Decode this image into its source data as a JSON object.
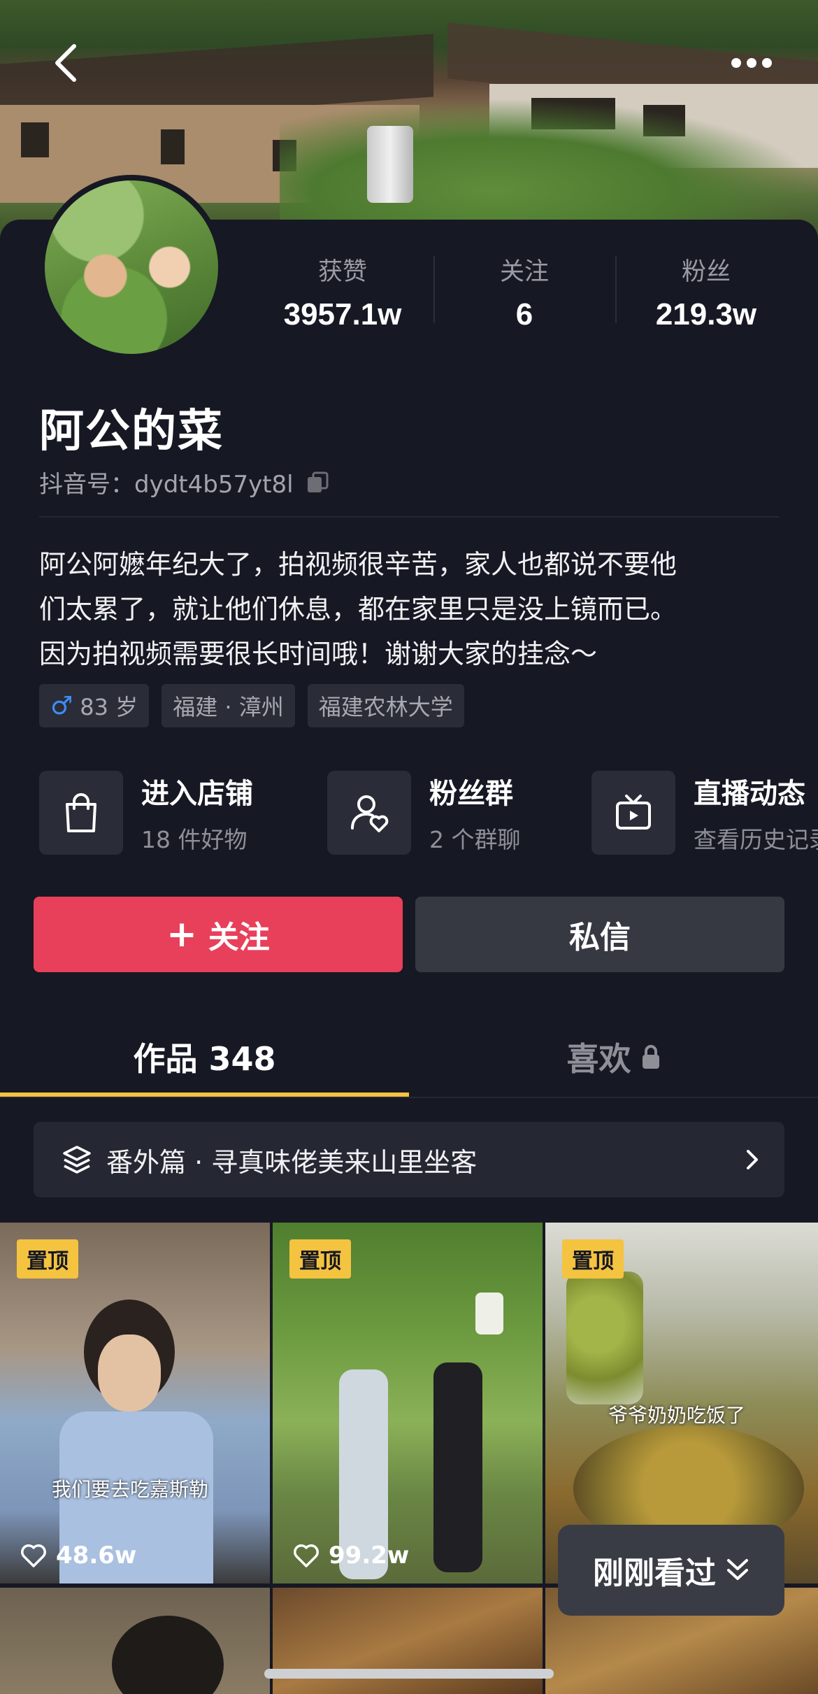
{
  "header": {
    "back_icon": "chevron-left-icon",
    "more_icon": "more-dots-icon"
  },
  "profile": {
    "stats": [
      {
        "label": "获赞",
        "value": "3957.1w"
      },
      {
        "label": "关注",
        "value": "6"
      },
      {
        "label": "粉丝",
        "value": "219.3w"
      }
    ],
    "name": "阿公的菜",
    "douyin_id": "抖音号：dydt4b57yt8l",
    "bio_lines": [
      "阿公阿嬷年纪大了，拍视频很辛苦，家人也都说不要他",
      "们太累了，就让他们休息，都在家里只是没上镜而已。",
      "因为拍视频需要很长时间哦！谢谢大家的挂念～"
    ],
    "tags": {
      "gender_symbol": "♂",
      "age": "83 岁",
      "location": "福建 · 漳州",
      "school": "福建农林大学"
    }
  },
  "features": [
    {
      "title": "进入店铺",
      "subtitle": "18 件好物",
      "icon": "shopping-bag-icon"
    },
    {
      "title": "粉丝群",
      "subtitle": "2 个群聊",
      "icon": "fan-group-icon"
    },
    {
      "title": "直播动态",
      "subtitle": "查看历史记录",
      "icon": "tv-live-icon"
    }
  ],
  "buttons": {
    "follow": "关注",
    "message": "私信"
  },
  "tabs": {
    "works": "作品 348",
    "likes": "喜欢"
  },
  "collection": {
    "label": "番外篇 · 寻真味佬美来山里坐客"
  },
  "videos": [
    {
      "pinned": "置顶",
      "likes": "48.6w",
      "caption": "我们要去吃嘉斯勒"
    },
    {
      "pinned": "置顶",
      "likes": "99.2w",
      "caption": ""
    },
    {
      "pinned": "置顶",
      "likes": "",
      "caption": "爷爷奶奶吃饭了"
    }
  ],
  "recent_button": "刚刚看过",
  "colors": {
    "background": "#161823",
    "follow_red": "#e8405a",
    "tab_underline": "#f4c340",
    "pin_yellow": "#f4c340",
    "gender_blue": "#3f8df5"
  }
}
